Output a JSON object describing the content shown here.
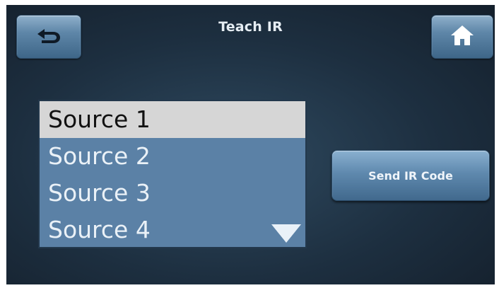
{
  "header": {
    "title": "Teach IR",
    "back_icon": "back-arrow-icon",
    "home_icon": "home-icon"
  },
  "source_list": {
    "items": [
      {
        "label": "Source 1",
        "selected": true
      },
      {
        "label": "Source 2",
        "selected": false
      },
      {
        "label": "Source 3",
        "selected": false
      },
      {
        "label": "Source 4",
        "selected": false
      }
    ],
    "scroll_icon": "triangle-down-icon"
  },
  "actions": {
    "send_label": "Send IR Code"
  },
  "colors": {
    "list_bg": "#5b81a6",
    "selected_bg": "#d6d6d6",
    "button_top": "#8fb0cb",
    "button_bottom": "#3e6688",
    "screen_bg": "#1d2f40"
  }
}
